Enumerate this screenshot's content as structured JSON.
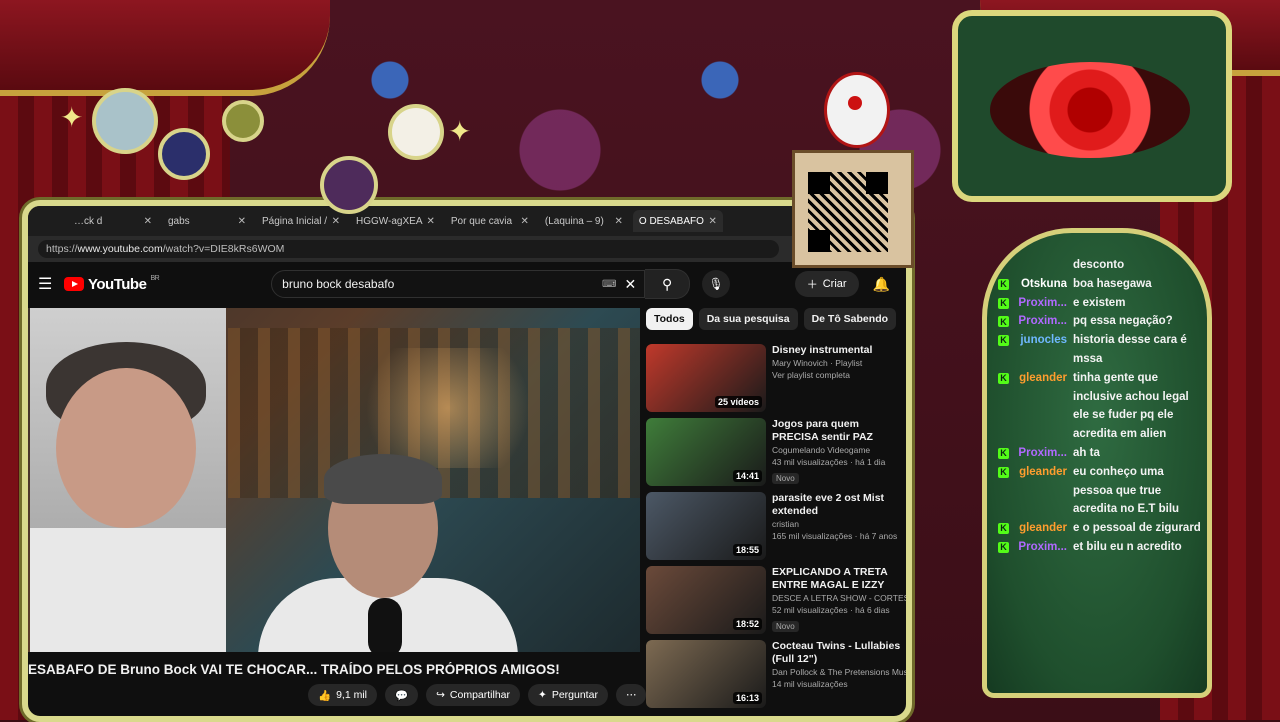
{
  "browser": {
    "tabs": [
      {
        "label": "…ck d",
        "active": false
      },
      {
        "label": "gabs",
        "active": false
      },
      {
        "label": "Página Inicial /",
        "active": false
      },
      {
        "label": "HGGW-agXEA",
        "active": false
      },
      {
        "label": "Por que cavia",
        "active": false
      },
      {
        "label": "(Laquina – 9)",
        "active": false
      },
      {
        "label": "O DESABAFO",
        "active": true
      }
    ],
    "url_scheme": "https://",
    "url_host": "www.youtube.com",
    "url_path": "/watch?v=DIE8kRs6WOM"
  },
  "youtube": {
    "logo_text": "YouTube",
    "country": "BR",
    "search_value": "bruno bock desabafo",
    "create_label": "Criar",
    "video_title": "ESABAFO DE Bruno Bock VAI TE CHOCAR... TRAÍDO PELOS PRÓPRIOS AMIGOS!",
    "actions": {
      "likes": "9,1 mil",
      "share_label": "Compartilhar",
      "ask_label": "Perguntar"
    },
    "chips": [
      "Todos",
      "Da sua pesquisa",
      "De Tô Sabendo"
    ],
    "recommendations": [
      {
        "title": "Disney instrumental",
        "channel": "Mary Winovich · Playlist",
        "meta": "Ver playlist completa",
        "badge": "25 vídeos",
        "thumb_color": "#c0392b"
      },
      {
        "title": "Jogos para quem PRECISA sentir PAZ",
        "channel": "Cogumelando Videogame",
        "meta": "43 mil visualizações · há 1 dia",
        "badge": "14:41",
        "new": "Novo",
        "thumb_color": "#3f7d3a"
      },
      {
        "title": "parasite eve 2 ost Mist extended",
        "channel": "cristian",
        "meta": "165 mil visualizações · há 7 anos",
        "badge": "18:55",
        "thumb_color": "#4c5866"
      },
      {
        "title": "EXPLICANDO A TRETA ENTRE MAGAL E IZZY NOBRE",
        "channel": "DESCE A LETRA SHOW - CORTES",
        "meta": "52 mil visualizações · há 6 dias",
        "badge": "18:52",
        "new": "Novo",
        "thumb_color": "#6b4a3a"
      },
      {
        "title": "Cocteau Twins - Lullabies (Full 12\")",
        "channel": "Dan Pollock & The Pretensions Music",
        "meta": "14 mil visualizações",
        "badge": "16:13",
        "thumb_color": "#7d6a52"
      }
    ]
  },
  "chat": {
    "messages": [
      {
        "user": "",
        "text": "desconto",
        "color": "#ffffff"
      },
      {
        "user": "Otskuna",
        "text": "boa hasegawa",
        "color": "#ffffff"
      },
      {
        "user": "Proxim...",
        "text": "e existem",
        "color": "#b069ff"
      },
      {
        "user": "Proxim...",
        "text": "pq essa negação?",
        "color": "#b069ff"
      },
      {
        "user": "junocles",
        "text": "historia desse cara é mssa",
        "color": "#6fb8ff"
      },
      {
        "user": "gleander",
        "text": "tinha gente que inclusive achou legal ele se fuder pq ele acredita em alien",
        "color": "#ff9d2e"
      },
      {
        "user": "Proxim...",
        "text": "ah ta",
        "color": "#b069ff"
      },
      {
        "user": "gleander",
        "text": "eu conheço uma pessoa que true acredita no E.T bilu",
        "color": "#ff9d2e"
      },
      {
        "user": "gleander",
        "text": "e o pessoal de zigurard",
        "color": "#ff9d2e"
      },
      {
        "user": "Proxim...",
        "text": "et bilu eu n acredito",
        "color": "#b069ff"
      }
    ]
  }
}
